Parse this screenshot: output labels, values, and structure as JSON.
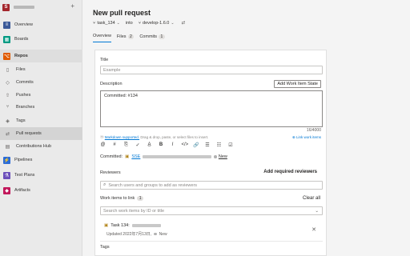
{
  "sidebar": {
    "project_initial": "S",
    "items": [
      {
        "label": "Overview",
        "icon": "overview-icon",
        "glyph": "≡",
        "color": "#3b5998"
      },
      {
        "label": "Boards",
        "icon": "boards-icon",
        "glyph": "▦",
        "color": "#009a82"
      },
      {
        "label": "Repos",
        "icon": "repos-icon",
        "glyph": "⌥",
        "color": "#e05a00"
      },
      {
        "label": "Files",
        "icon": "files-icon",
        "glyph": "▯"
      },
      {
        "label": "Commits",
        "icon": "commits-icon",
        "glyph": "◇"
      },
      {
        "label": "Pushes",
        "icon": "pushes-icon",
        "glyph": "⇧"
      },
      {
        "label": "Branches",
        "icon": "branches-icon",
        "glyph": "⑂"
      },
      {
        "label": "Tags",
        "icon": "tags-icon",
        "glyph": "◈"
      },
      {
        "label": "Pull requests",
        "icon": "pull-requests-icon",
        "glyph": "⇄"
      },
      {
        "label": "Contributions Hub",
        "icon": "contributions-hub-icon",
        "glyph": "▤"
      },
      {
        "label": "Pipelines",
        "icon": "pipelines-icon",
        "glyph": "⚡",
        "color": "#2b6cd8"
      },
      {
        "label": "Test Plans",
        "icon": "test-plans-icon",
        "glyph": "⚗",
        "color": "#6b4fbb"
      },
      {
        "label": "Artifacts",
        "icon": "artifacts-icon",
        "glyph": "◆",
        "color": "#c2185b"
      }
    ]
  },
  "header": {
    "title": "New pull request",
    "source_branch": "task_134",
    "into": "into",
    "target_branch": "develop-1.6.0",
    "swap_glyph": "⇄"
  },
  "tabs": [
    {
      "label": "Overview"
    },
    {
      "label": "Files",
      "count": "2"
    },
    {
      "label": "Commits",
      "count": "1"
    }
  ],
  "form": {
    "title_label": "Title",
    "title_value": "Example",
    "description_label": "Description",
    "add_work_item_state": "Add Work Item State",
    "description_value": "Committed: #134",
    "char_count": "16/4000",
    "markdown_link": "Markdown supported.",
    "markdown_hint": "Drag & drop, paste, or select files to insert.",
    "link_work_items": "Link work items",
    "toolbar": [
      "@",
      "#",
      "⎘",
      "✓",
      "A̲",
      "B",
      "I",
      "</>",
      "🔗",
      "☰",
      "☷",
      "☑"
    ],
    "committed_label": "Committed:",
    "committed_ref": "SSE",
    "committed_state": "New",
    "reviewers_label": "Reviewers",
    "add_required_reviewers": "Add required reviewers",
    "reviewers_placeholder": "Search users and groups to add as reviewers",
    "work_items_label": "Work items to link",
    "work_items_count": "1",
    "clear_all": "Clear all",
    "work_items_placeholder": "Search work items by ID or title",
    "work_item_title": "Task 134:",
    "work_item_updated": "Updated 2022年7月13日,",
    "work_item_state": "New",
    "tags_label": "Tags"
  },
  "colors": {
    "accent": "#0078d4",
    "repos_brand": "#e05a00"
  }
}
